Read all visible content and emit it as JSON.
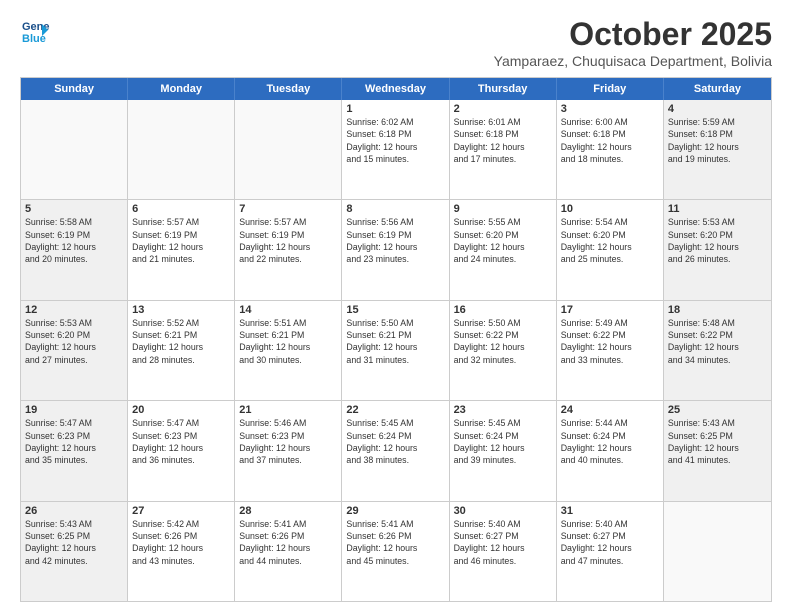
{
  "header": {
    "logo_line1": "General",
    "logo_line2": "Blue",
    "month": "October 2025",
    "location": "Yamparaez, Chuquisaca Department, Bolivia"
  },
  "days_of_week": [
    "Sunday",
    "Monday",
    "Tuesday",
    "Wednesday",
    "Thursday",
    "Friday",
    "Saturday"
  ],
  "rows": [
    [
      {
        "day": "",
        "info": "",
        "empty": true
      },
      {
        "day": "",
        "info": "",
        "empty": true
      },
      {
        "day": "",
        "info": "",
        "empty": true
      },
      {
        "day": "1",
        "info": "Sunrise: 6:02 AM\nSunset: 6:18 PM\nDaylight: 12 hours\nand 15 minutes.",
        "empty": false
      },
      {
        "day": "2",
        "info": "Sunrise: 6:01 AM\nSunset: 6:18 PM\nDaylight: 12 hours\nand 17 minutes.",
        "empty": false
      },
      {
        "day": "3",
        "info": "Sunrise: 6:00 AM\nSunset: 6:18 PM\nDaylight: 12 hours\nand 18 minutes.",
        "empty": false
      },
      {
        "day": "4",
        "info": "Sunrise: 5:59 AM\nSunset: 6:18 PM\nDaylight: 12 hours\nand 19 minutes.",
        "empty": false,
        "shaded": true
      }
    ],
    [
      {
        "day": "5",
        "info": "Sunrise: 5:58 AM\nSunset: 6:19 PM\nDaylight: 12 hours\nand 20 minutes.",
        "empty": false,
        "shaded": true
      },
      {
        "day": "6",
        "info": "Sunrise: 5:57 AM\nSunset: 6:19 PM\nDaylight: 12 hours\nand 21 minutes.",
        "empty": false
      },
      {
        "day": "7",
        "info": "Sunrise: 5:57 AM\nSunset: 6:19 PM\nDaylight: 12 hours\nand 22 minutes.",
        "empty": false
      },
      {
        "day": "8",
        "info": "Sunrise: 5:56 AM\nSunset: 6:19 PM\nDaylight: 12 hours\nand 23 minutes.",
        "empty": false
      },
      {
        "day": "9",
        "info": "Sunrise: 5:55 AM\nSunset: 6:20 PM\nDaylight: 12 hours\nand 24 minutes.",
        "empty": false
      },
      {
        "day": "10",
        "info": "Sunrise: 5:54 AM\nSunset: 6:20 PM\nDaylight: 12 hours\nand 25 minutes.",
        "empty": false
      },
      {
        "day": "11",
        "info": "Sunrise: 5:53 AM\nSunset: 6:20 PM\nDaylight: 12 hours\nand 26 minutes.",
        "empty": false,
        "shaded": true
      }
    ],
    [
      {
        "day": "12",
        "info": "Sunrise: 5:53 AM\nSunset: 6:20 PM\nDaylight: 12 hours\nand 27 minutes.",
        "empty": false,
        "shaded": true
      },
      {
        "day": "13",
        "info": "Sunrise: 5:52 AM\nSunset: 6:21 PM\nDaylight: 12 hours\nand 28 minutes.",
        "empty": false
      },
      {
        "day": "14",
        "info": "Sunrise: 5:51 AM\nSunset: 6:21 PM\nDaylight: 12 hours\nand 30 minutes.",
        "empty": false
      },
      {
        "day": "15",
        "info": "Sunrise: 5:50 AM\nSunset: 6:21 PM\nDaylight: 12 hours\nand 31 minutes.",
        "empty": false
      },
      {
        "day": "16",
        "info": "Sunrise: 5:50 AM\nSunset: 6:22 PM\nDaylight: 12 hours\nand 32 minutes.",
        "empty": false
      },
      {
        "day": "17",
        "info": "Sunrise: 5:49 AM\nSunset: 6:22 PM\nDaylight: 12 hours\nand 33 minutes.",
        "empty": false
      },
      {
        "day": "18",
        "info": "Sunrise: 5:48 AM\nSunset: 6:22 PM\nDaylight: 12 hours\nand 34 minutes.",
        "empty": false,
        "shaded": true
      }
    ],
    [
      {
        "day": "19",
        "info": "Sunrise: 5:47 AM\nSunset: 6:23 PM\nDaylight: 12 hours\nand 35 minutes.",
        "empty": false,
        "shaded": true
      },
      {
        "day": "20",
        "info": "Sunrise: 5:47 AM\nSunset: 6:23 PM\nDaylight: 12 hours\nand 36 minutes.",
        "empty": false
      },
      {
        "day": "21",
        "info": "Sunrise: 5:46 AM\nSunset: 6:23 PM\nDaylight: 12 hours\nand 37 minutes.",
        "empty": false
      },
      {
        "day": "22",
        "info": "Sunrise: 5:45 AM\nSunset: 6:24 PM\nDaylight: 12 hours\nand 38 minutes.",
        "empty": false
      },
      {
        "day": "23",
        "info": "Sunrise: 5:45 AM\nSunset: 6:24 PM\nDaylight: 12 hours\nand 39 minutes.",
        "empty": false
      },
      {
        "day": "24",
        "info": "Sunrise: 5:44 AM\nSunset: 6:24 PM\nDaylight: 12 hours\nand 40 minutes.",
        "empty": false
      },
      {
        "day": "25",
        "info": "Sunrise: 5:43 AM\nSunset: 6:25 PM\nDaylight: 12 hours\nand 41 minutes.",
        "empty": false,
        "shaded": true
      }
    ],
    [
      {
        "day": "26",
        "info": "Sunrise: 5:43 AM\nSunset: 6:25 PM\nDaylight: 12 hours\nand 42 minutes.",
        "empty": false,
        "shaded": true
      },
      {
        "day": "27",
        "info": "Sunrise: 5:42 AM\nSunset: 6:26 PM\nDaylight: 12 hours\nand 43 minutes.",
        "empty": false
      },
      {
        "day": "28",
        "info": "Sunrise: 5:41 AM\nSunset: 6:26 PM\nDaylight: 12 hours\nand 44 minutes.",
        "empty": false
      },
      {
        "day": "29",
        "info": "Sunrise: 5:41 AM\nSunset: 6:26 PM\nDaylight: 12 hours\nand 45 minutes.",
        "empty": false
      },
      {
        "day": "30",
        "info": "Sunrise: 5:40 AM\nSunset: 6:27 PM\nDaylight: 12 hours\nand 46 minutes.",
        "empty": false
      },
      {
        "day": "31",
        "info": "Sunrise: 5:40 AM\nSunset: 6:27 PM\nDaylight: 12 hours\nand 47 minutes.",
        "empty": false
      },
      {
        "day": "",
        "info": "",
        "empty": true,
        "shaded": true
      }
    ]
  ]
}
